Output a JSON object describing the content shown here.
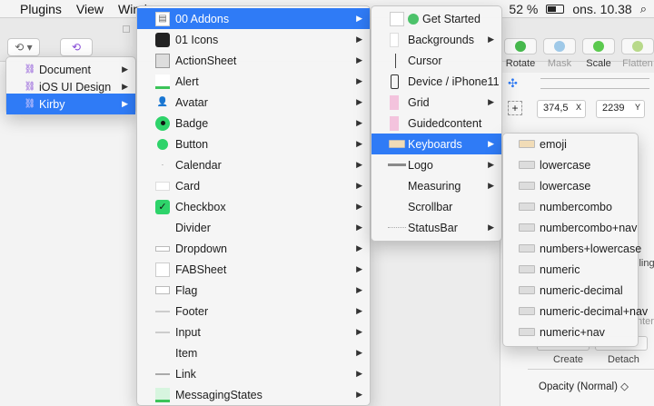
{
  "menubar": {
    "items": [
      "",
      "Plugins",
      "View",
      "Windo"
    ],
    "battery": "52 %",
    "clock": "ons. 10.38"
  },
  "toolbar": {
    "tools": [
      {
        "label": "Rotate",
        "icon": "rotate-icon",
        "color": "#46b84d"
      },
      {
        "label": "Mask",
        "icon": "mask-icon",
        "color": "#9fc9e8"
      },
      {
        "label": "Scale",
        "icon": "scale-icon",
        "color": "#5bc94e"
      },
      {
        "label": "Flatten",
        "icon": "flatten-icon",
        "color": "#b8d98a"
      }
    ]
  },
  "menu1": {
    "items": [
      {
        "label": "Document",
        "icon": "link-icon"
      },
      {
        "label": "iOS UI Design",
        "icon": "link-icon"
      },
      {
        "label": "Kirby",
        "icon": "link-icon",
        "selected": true
      }
    ]
  },
  "menu2": {
    "items": [
      {
        "label": "00 Addons",
        "selected": true
      },
      {
        "label": "01 Icons"
      },
      {
        "label": "ActionSheet"
      },
      {
        "label": "Alert"
      },
      {
        "label": "Avatar"
      },
      {
        "label": "Badge"
      },
      {
        "label": "Button"
      },
      {
        "label": "Calendar"
      },
      {
        "label": "Card"
      },
      {
        "label": "Checkbox"
      },
      {
        "label": "Divider"
      },
      {
        "label": "Dropdown"
      },
      {
        "label": "FABSheet"
      },
      {
        "label": "Flag"
      },
      {
        "label": "Footer"
      },
      {
        "label": "Input"
      },
      {
        "label": "Item"
      },
      {
        "label": "Link"
      },
      {
        "label": "MessagingStates"
      }
    ]
  },
  "menu3": {
    "items": [
      {
        "label": "Get Started",
        "arrow": false
      },
      {
        "label": "Backgrounds",
        "arrow": true
      },
      {
        "label": "Cursor",
        "arrow": false
      },
      {
        "label": "Device / iPhone11",
        "arrow": false
      },
      {
        "label": "Grid",
        "arrow": true
      },
      {
        "label": "Guidedcontent",
        "arrow": false
      },
      {
        "label": "Keyboards",
        "arrow": true,
        "selected": true
      },
      {
        "label": "Logo",
        "arrow": true
      },
      {
        "label": "Measuring",
        "arrow": true
      },
      {
        "label": "Scrollbar",
        "arrow": false
      },
      {
        "label": "StatusBar",
        "arrow": true
      }
    ]
  },
  "menu4": {
    "items": [
      "emoji",
      "lowercase",
      "lowercase",
      "numbercombo",
      "numbercombo+nav",
      "numbers+lowercase",
      "numeric",
      "numeric-decimal",
      "numeric-decimal+nav",
      "numeric+nav"
    ]
  },
  "inspector": {
    "x_value": "374,5",
    "x_label": "X",
    "y_value": "2239",
    "y_label": "Y",
    "partial_text_1": "lling",
    "partial_text_2": "nter/",
    "create_label": "Create",
    "detach_label": "Detach",
    "opacity_label": "Opacity (Normal)"
  }
}
